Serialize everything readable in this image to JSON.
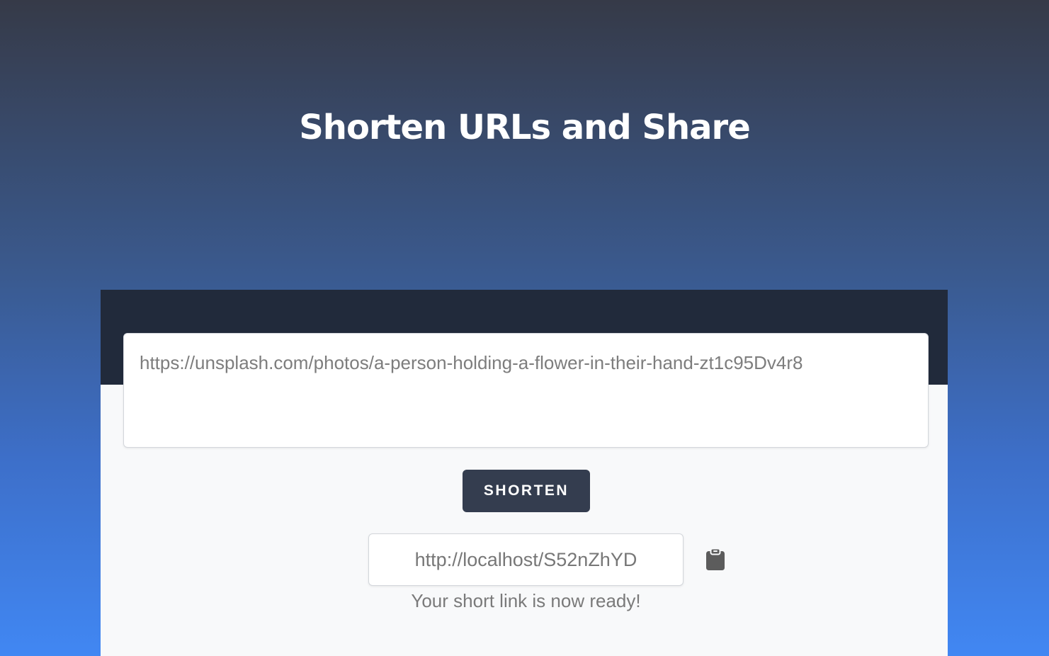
{
  "hero": {
    "title": "Shorten URLs and Share"
  },
  "shortener": {
    "long_url_value": "https://unsplash.com/photos/a-person-holding-a-flower-in-their-hand-zt1c95Dv4r8",
    "shorten_label": "SHORTEN",
    "short_url_value": "http://localhost/S52nZhYD",
    "copy_icon": "clipboard-icon",
    "status_message": "Your short link is now ready!"
  },
  "colors": {
    "header_dark": "#212a3b",
    "button": "#343d4f",
    "gradient_top": "#363a48",
    "gradient_bottom": "#4187f3"
  }
}
